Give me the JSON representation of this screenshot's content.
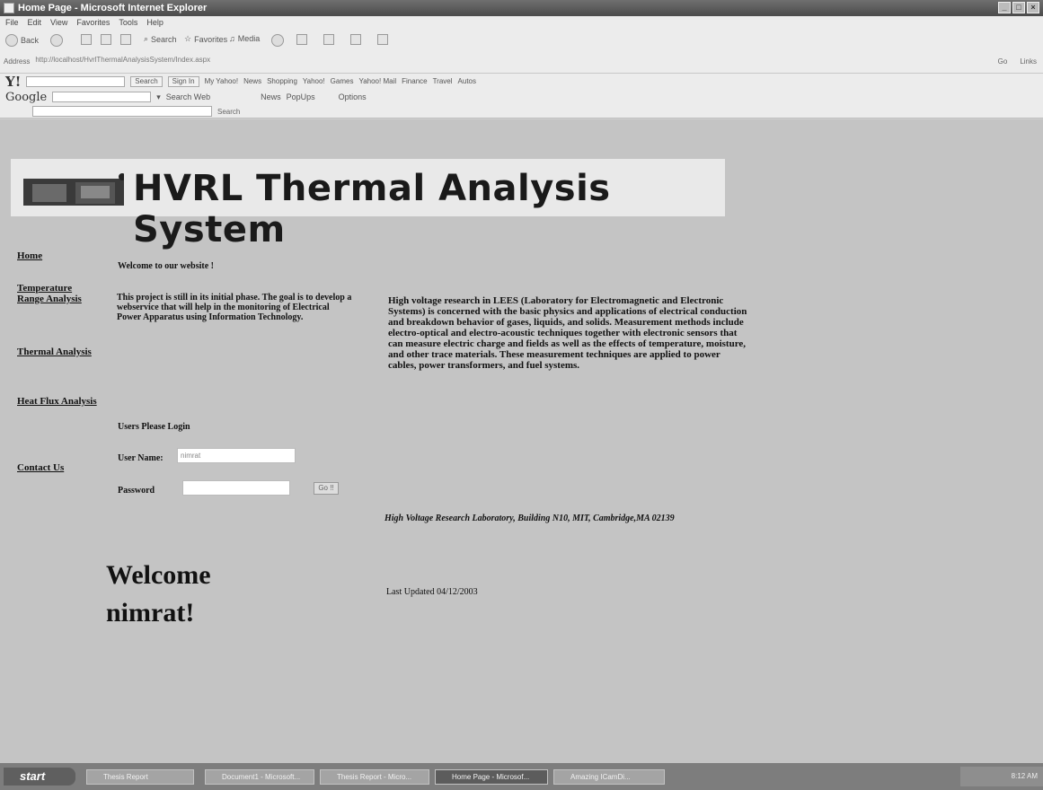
{
  "window": {
    "title": "Home Page - Microsoft Internet Explorer"
  },
  "menu": [
    "File",
    "Edit",
    "View",
    "Favorites",
    "Tools",
    "Help"
  ],
  "toolbar": {
    "back": "Back",
    "search": "Search",
    "favorites": "Favorites",
    "media": "Media"
  },
  "address": {
    "label": "Address",
    "url": "http://localhost/HvrlThermalAnalysisSystem/Index.aspx",
    "go": "Go",
    "links": "Links"
  },
  "yahoo": {
    "logo": "Y!",
    "search": "Search",
    "sign_in": "Sign In",
    "items": [
      "My Yahoo!",
      "News",
      "Shopping",
      "Yahoo!",
      "Games",
      "Yahoo! Mail",
      "Finance",
      "Travel",
      "Autos"
    ]
  },
  "google": {
    "logo": "Google",
    "search_web": "Search Web",
    "news": "News",
    "popups": "PopUps",
    "options": "Options"
  },
  "site": {
    "title": "HVRL Thermal Analysis System",
    "nav": [
      "Home",
      "Temperature Range Analysis",
      "Thermal Analysis",
      "Heat Flux Analysis",
      "Contact Us"
    ],
    "welcome": "Welcome to our website !",
    "intro": "This project is still in its initial phase. The goal is to develop a webservice that will help in the monitoring of Electrical Power Apparatus using Information Technology.",
    "description": "High voltage research in LEES (Laboratory for Electromagnetic and Electronic Systems) is concerned with the basic physics and applications of electrical conduction and breakdown behavior of gases, liquids, and solids. Measurement methods include electro-optical and electro-acoustic techniques together with electronic sensors that can measure electric charge and fields as well as the effects of temperature, moisture, and other trace materials. These measurement techniques are applied to power cables, power transformers, and fuel systems.",
    "login_title": "Users Please Login",
    "username_label": "User Name:",
    "username_value": "nimrat",
    "password_label": "Password",
    "go": "Go !!",
    "address": "High Voltage Research Laboratory, Building N10, MIT, Cambridge,MA 02139",
    "updated": "Last Updated 04/12/2003",
    "big_welcome_1": "Welcome",
    "big_welcome_2": "nimrat!"
  },
  "taskbar": {
    "start": "start",
    "items": [
      "Thesis Report",
      "Document1 - Microsoft...",
      "Thesis Report - Micro...",
      "Home Page - Microsof...",
      "Amazing ICamDi..."
    ],
    "clock": "8:12 AM"
  }
}
